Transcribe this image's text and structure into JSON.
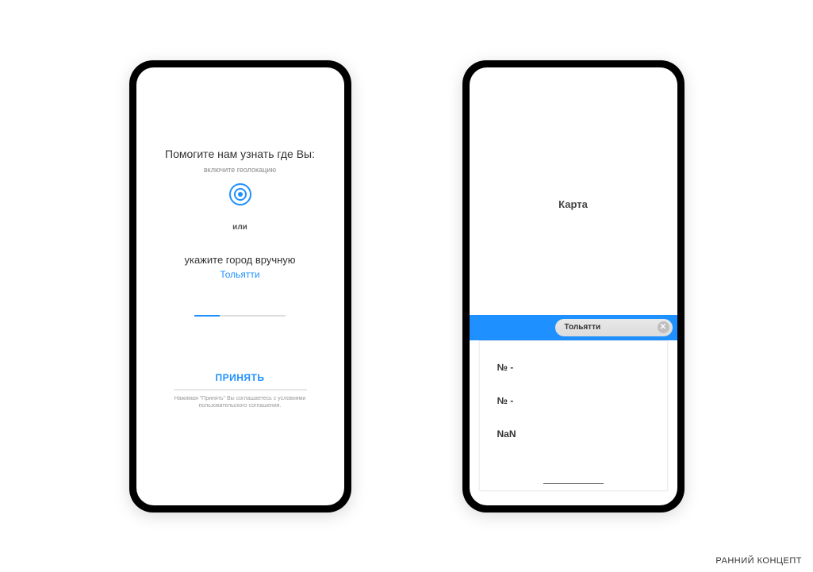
{
  "footer": {
    "caption": "РАННИЙ КОНЦЕПТ"
  },
  "screen1": {
    "heading": "Помогите нам узнать где Вы:",
    "geo_sub": "включите геолокацию",
    "or": "или",
    "manual_label": "укажите город вручную",
    "city": "Тольятти",
    "accept": "ПРИНЯТЬ",
    "legal": "Нажимая \"Принять\" Вы соглашаетесь с условиями пользовательского соглашения."
  },
  "screen2": {
    "map_label": "Карта",
    "search_value": "Тольятти",
    "results": [
      "№ -",
      "№ -",
      "NaN"
    ]
  }
}
